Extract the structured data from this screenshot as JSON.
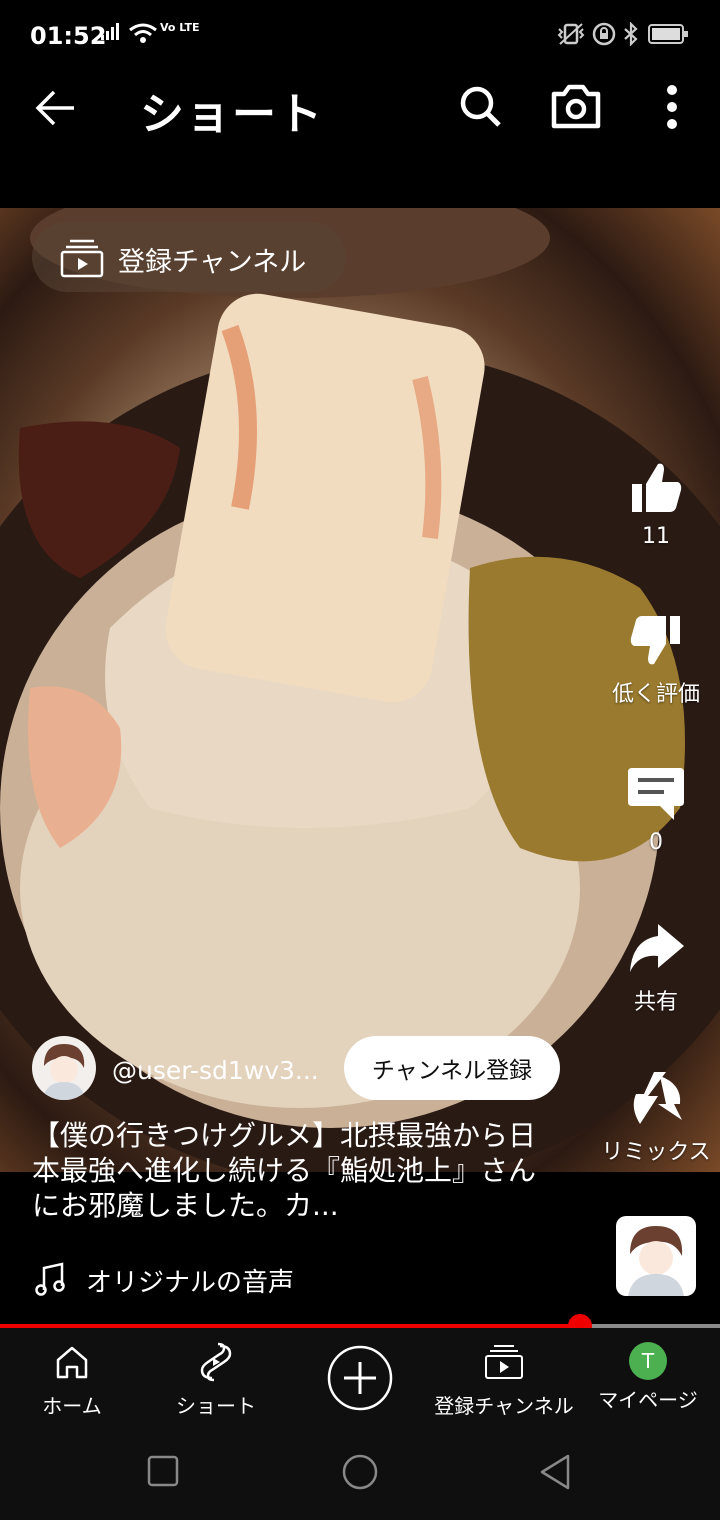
{
  "status_bar": {
    "time": "01:52",
    "network_label": "Vo LTE"
  },
  "header": {
    "title": "ショート"
  },
  "video": {
    "subscriptions_pill": "登録チャンネル",
    "actions": {
      "like_count": "11",
      "dislike_label": "低く評価",
      "comment_count": "0",
      "share_label": "共有",
      "remix_label": "リミックス"
    },
    "channel": {
      "name": "@user-sd1wv3...",
      "subscribe_label": "チャンネル登録"
    },
    "title": "【僕の行きつけグルメ】北摂最強から日本最強へ進化し続ける『鮨処池上』さんにお邪魔しました。カ...",
    "audio_label": "オリジナルの音声",
    "progress": 0.806
  },
  "bottom_nav": {
    "home": "ホーム",
    "shorts": "ショート",
    "subscriptions": "登録チャンネル",
    "you": "マイページ",
    "avatar_letter": "T"
  },
  "colors": {
    "accent_red": "#ee0000",
    "avatar_green": "#4caf50"
  }
}
